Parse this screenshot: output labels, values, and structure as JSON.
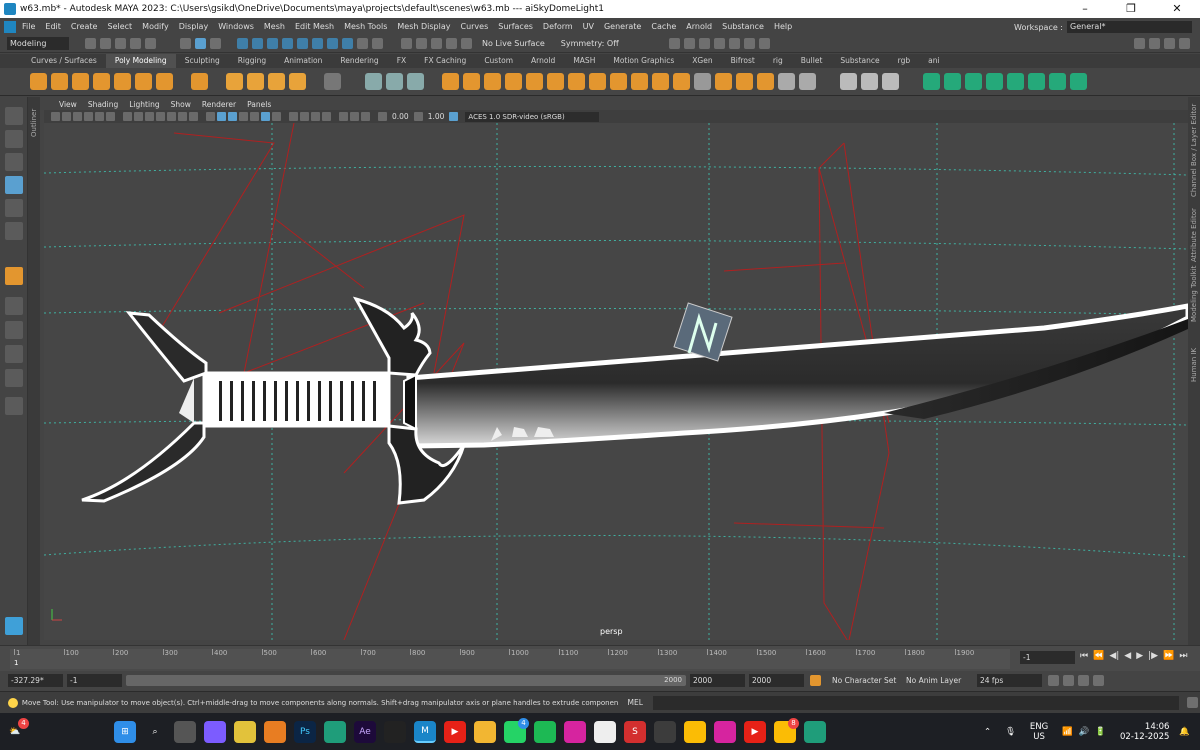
{
  "window": {
    "title": "w63.mb* - Autodesk MAYA 2023: C:\\Users\\gsikd\\OneDrive\\Documents\\maya\\projects\\default\\scenes\\w63.mb   ---   aiSkyDomeLight1"
  },
  "menus": [
    "File",
    "Edit",
    "Create",
    "Select",
    "Modify",
    "Display",
    "Windows",
    "Mesh",
    "Edit Mesh",
    "Mesh Tools",
    "Mesh Display",
    "Curves",
    "Surfaces",
    "Deform",
    "UV",
    "Generate",
    "Cache",
    "Arnold",
    "Substance",
    "Help"
  ],
  "workspace": {
    "label": "Workspace :",
    "value": "General*"
  },
  "statusline": {
    "mode": "Modeling",
    "live_surface": "No Live Surface",
    "symmetry": "Symmetry: Off"
  },
  "shelf_tabs": [
    "Curves / Surfaces",
    "Poly Modeling",
    "Sculpting",
    "Rigging",
    "Animation",
    "Rendering",
    "FX",
    "FX Caching",
    "Custom",
    "Arnold",
    "MASH",
    "Motion Graphics",
    "XGen",
    "Bifrost",
    "rig",
    "Bullet",
    "Substance",
    "rgb",
    "ani"
  ],
  "active_shelf": "Poly Modeling",
  "panel_menus": [
    "View",
    "Shading",
    "Lighting",
    "Show",
    "Renderer",
    "Panels"
  ],
  "panel_tool": {
    "exposure": "0.00",
    "gamma": "1.00",
    "color_space": "ACES 1.0 SDR-video (sRGB)"
  },
  "side_labels": {
    "left": "Outliner",
    "right": [
      "Channel Box / Layer Editor",
      "Attribute Editor",
      "Modeling Toolkit",
      "Human IK"
    ]
  },
  "viewport": {
    "camera": "persp"
  },
  "timeline": {
    "ticks": [
      "1",
      "100",
      "200",
      "300",
      "400",
      "500",
      "600",
      "700",
      "800",
      "900",
      "1000",
      "1100",
      "1200",
      "1300",
      "1400",
      "1500",
      "1600",
      "1700",
      "1800",
      "1900"
    ],
    "current_frame": "1"
  },
  "range": {
    "start_val": "-327.29*",
    "start": "-1",
    "slider_end": "2000",
    "end": "2000",
    "max": "2000",
    "character_set": "No Character Set",
    "anim_layer": "No Anim Layer",
    "fps": "24 fps"
  },
  "helpline": {
    "text": "Move Tool: Use manipulator to move object(s). Ctrl+middle-drag to move components along normals. Shift+drag manipulator axis or plane handles to extrude components or clone objects. Ctrl+Shift+drag to con",
    "script_lang": "MEL"
  },
  "taskbar": {
    "weather_badge": "4",
    "whatsapp_badge": "4",
    "chrome_badge": "8",
    "lang": "ENG",
    "region": "US",
    "time": "14:06",
    "date": "02-12-2025"
  },
  "colors": {
    "accent": "#5aa0d0",
    "grid_h": "#3fb0a0",
    "grid_v": "#3aa088",
    "red_lines": "#b02020"
  }
}
